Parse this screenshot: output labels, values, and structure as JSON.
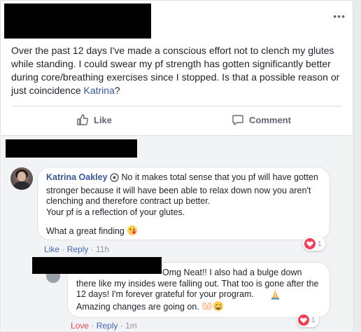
{
  "post": {
    "more_label": "•••",
    "text": "Over the past 12 days I've made a conscious effort not to clench my glutes while standing. I could swear my pf strength has gotten significantly better during core/breathing exercises since I stopped. Is that a possible reason or just coincidence",
    "mention": "Katrina",
    "text_end": "?"
  },
  "actions": {
    "like_label": "Like",
    "comment_label": "Comment"
  },
  "comments": [
    {
      "author": "Katrina Oakley",
      "text_line1": " No it makes total sense that you pf will have gotten stronger because it will have been able to relax down now you aren't clenching and therefore contract up better.",
      "text_line2": "Your pf is a reflection of your glutes.",
      "text_line3": "What a great finding ",
      "like_label": "Like",
      "reply_label": "Reply",
      "time": "11h",
      "reaction_count": "1"
    },
    {
      "author": "",
      "text": "Omg Neat!! I also had a bulge down there like my insides were falling out. That too is gone after the 12 days! I'm forever grateful for your program.",
      "text_line2": "Amazing changes are going on. ",
      "love_label": "Love",
      "reply_label": "Reply",
      "time": "1m",
      "reaction_count": "1"
    }
  ],
  "colors": {
    "link": "#385898",
    "meta": "#90949c",
    "love": "#f33e58"
  },
  "icons": [
    "thumbs-up-icon",
    "comment-icon",
    "smirk-emoji-icon",
    "praying-hands-emoji-icon",
    "raised-hands-emoji-icon",
    "grin-emoji-icon",
    "heart-reaction-icon"
  ]
}
